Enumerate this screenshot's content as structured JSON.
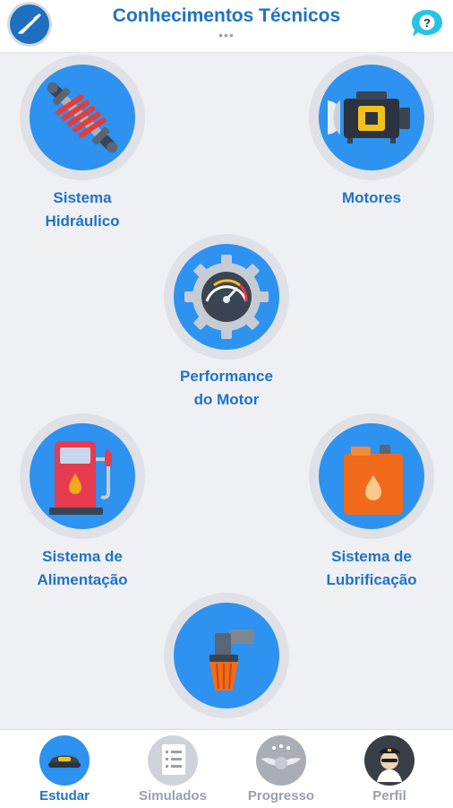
{
  "header": {
    "title": "Conhecimentos Técnicos",
    "dots": "•••",
    "help_glyph": "?",
    "logo_icon": "airplane-icon",
    "help_icon": "help-chat-icon"
  },
  "topics": [
    {
      "line1": "Sistema",
      "line2": "Hidráulico",
      "icon": "shock-absorber-icon"
    },
    {
      "line1": "Motores",
      "line2": "",
      "icon": "engine-icon"
    },
    {
      "line1": "Performance",
      "line2": "do Motor",
      "icon": "gear-gauge-icon"
    },
    {
      "line1": "Sistema de",
      "line2": "Alimentação",
      "icon": "fuel-pump-icon"
    },
    {
      "line1": "Sistema de",
      "line2": "Lubrificação",
      "icon": "oil-can-icon"
    },
    {
      "line1": "",
      "line2": "",
      "icon": "exhaust-filter-icon"
    }
  ],
  "tabs": [
    {
      "label": "Estudar",
      "active": true,
      "icon": "pilot-cap-icon"
    },
    {
      "label": "Simulados",
      "active": false,
      "icon": "checklist-icon"
    },
    {
      "label": "Progresso",
      "active": false,
      "icon": "wings-badge-icon"
    },
    {
      "label": "Perfil",
      "active": false,
      "icon": "pilot-avatar-icon"
    }
  ],
  "colors": {
    "accent": "#1f72c8",
    "disc": "#2d92f0",
    "inactive": "#9aa0a8"
  }
}
